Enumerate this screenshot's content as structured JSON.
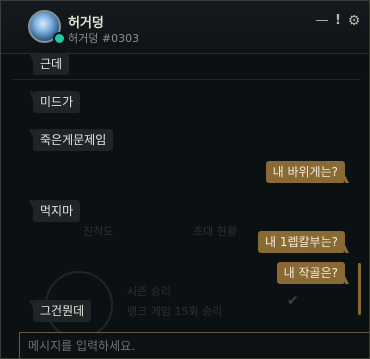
{
  "header": {
    "name": "허거덩",
    "tag": "허거덩 #0303",
    "minimize_label": "—",
    "alert_label": "!",
    "settings_label": "⚙"
  },
  "background_ghost": {
    "tab_progress": "진척도",
    "tab_invite": "초대 현황",
    "season_win": "시즌 승리",
    "rank_wins": "랭크 게임 15회 승리"
  },
  "messages": [
    {
      "side": "in",
      "text": "근데"
    },
    {
      "side": "in",
      "text": "미드가"
    },
    {
      "side": "in",
      "text": "죽은게문제임"
    },
    {
      "side": "out",
      "text": "내 바위게는?"
    },
    {
      "side": "in",
      "text": "먹지마"
    },
    {
      "side": "out",
      "text": "내 1렙칼부는?"
    },
    {
      "side": "out",
      "text": "내 작골은?"
    },
    {
      "side": "in",
      "text": "그건뭔데"
    }
  ],
  "input": {
    "placeholder": "메시지를 입력하세요.",
    "value": ""
  },
  "colors": {
    "accent": "#8a6a34",
    "incoming_bubble": "#1e2428",
    "online": "#1ec9a3"
  }
}
